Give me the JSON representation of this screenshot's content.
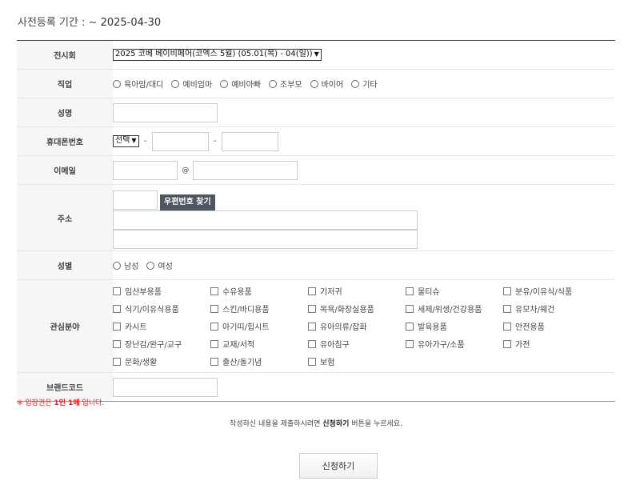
{
  "period": {
    "label": "사전등록 기간 : ~ ",
    "date": "2025-04-30"
  },
  "form": {
    "exhibition": {
      "label": "전시회",
      "selected": "2025 코베 베이비페어(코엑스 5월) (05.01(목) - 04(일))"
    },
    "job": {
      "label": "직업",
      "options": [
        "육아맘/대디",
        "예비엄마",
        "예비아빠",
        "조부모",
        "바이어",
        "기타"
      ]
    },
    "name": {
      "label": "성명"
    },
    "phone": {
      "label": "휴대폰번호",
      "prefix_selected": "선택",
      "separator": "-"
    },
    "email": {
      "label": "이메일",
      "at": "@"
    },
    "address": {
      "label": "주소",
      "zip_button": "우편번호 찾기"
    },
    "gender": {
      "label": "성별",
      "options": [
        "남성",
        "여성"
      ]
    },
    "interests": {
      "label": "관심분야",
      "options": [
        "임산부용품",
        "수유용품",
        "기저귀",
        "물티슈",
        "분유/이유식/식품",
        "식기/이유식용품",
        "스킨/바디용품",
        "목욕/화장실용품",
        "세제/위생/건강용품",
        "유모차/웨건",
        "카시트",
        "아기띠/힙시트",
        "유아의류/잡화",
        "발육용품",
        "안전용품",
        "장난감/완구/교구",
        "교재/서적",
        "유아침구",
        "유아가구/소품",
        "가전",
        "문화/생활",
        "출산/돌기념",
        "보험"
      ]
    },
    "brand_code": {
      "label": "브랜드코드"
    }
  },
  "notice": {
    "prefix": "※ 입장권은 ",
    "bold": "1인 1매",
    "suffix": " 입니다."
  },
  "guide": {
    "prefix": "작성하신 내용을 제출하시려면 ",
    "bold": "신청하기",
    "suffix": " 버튼을 누르세요."
  },
  "submit_label": "신청하기"
}
